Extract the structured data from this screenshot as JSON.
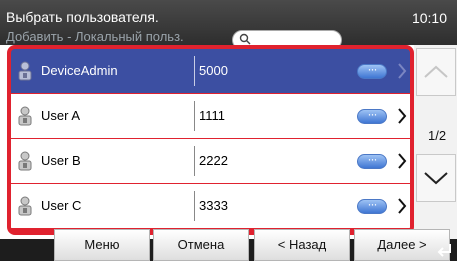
{
  "header": {
    "title": "Выбрать пользователя.",
    "subtitle": "Добавить - Локальный польз.",
    "time": "10:10"
  },
  "users": [
    {
      "name": "DeviceAdmin",
      "code": "5000",
      "selected": true
    },
    {
      "name": "User A",
      "code": "1111",
      "selected": false
    },
    {
      "name": "User B",
      "code": "2222",
      "selected": false
    },
    {
      "name": "User C",
      "code": "3333",
      "selected": false
    }
  ],
  "pager": {
    "indicator": "1/2"
  },
  "footer": {
    "menu": "Меню",
    "cancel": "Отмена",
    "back": "< Назад",
    "next": "Далее >"
  },
  "colors": {
    "selected_row": "#3c4fa2",
    "highlight_frame": "#e0222f",
    "header_bg": "#3a3a3a"
  }
}
